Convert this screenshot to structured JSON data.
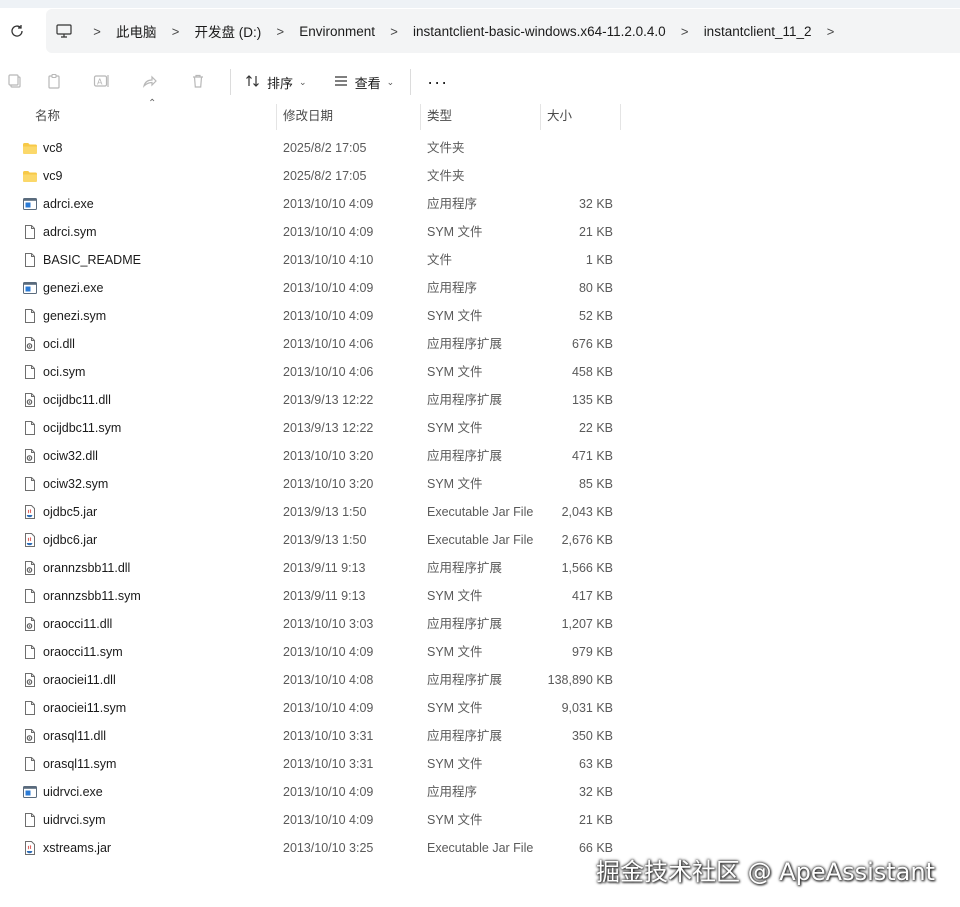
{
  "breadcrumb": [
    {
      "label": "此电脑"
    },
    {
      "label": "开发盘 (D:)"
    },
    {
      "label": "Environment"
    },
    {
      "label": "instantclient-basic-windows.x64-11.2.0.4.0"
    },
    {
      "label": "instantclient_11_2"
    }
  ],
  "toolbar": {
    "sort_label": "排序",
    "view_label": "查看",
    "more_label": "···"
  },
  "columns": {
    "name": "名称",
    "date": "修改日期",
    "type": "类型",
    "size": "大小"
  },
  "files": [
    {
      "icon": "folder",
      "name": "vc8",
      "date": "2025/8/2 17:05",
      "type": "文件夹",
      "size": ""
    },
    {
      "icon": "folder",
      "name": "vc9",
      "date": "2025/8/2 17:05",
      "type": "文件夹",
      "size": ""
    },
    {
      "icon": "exe",
      "name": "adrci.exe",
      "date": "2013/10/10 4:09",
      "type": "应用程序",
      "size": "32 KB"
    },
    {
      "icon": "file",
      "name": "adrci.sym",
      "date": "2013/10/10 4:09",
      "type": "SYM 文件",
      "size": "21 KB"
    },
    {
      "icon": "file",
      "name": "BASIC_README",
      "date": "2013/10/10 4:10",
      "type": "文件",
      "size": "1 KB"
    },
    {
      "icon": "exe",
      "name": "genezi.exe",
      "date": "2013/10/10 4:09",
      "type": "应用程序",
      "size": "80 KB"
    },
    {
      "icon": "file",
      "name": "genezi.sym",
      "date": "2013/10/10 4:09",
      "type": "SYM 文件",
      "size": "52 KB"
    },
    {
      "icon": "dll",
      "name": "oci.dll",
      "date": "2013/10/10 4:06",
      "type": "应用程序扩展",
      "size": "676 KB"
    },
    {
      "icon": "file",
      "name": "oci.sym",
      "date": "2013/10/10 4:06",
      "type": "SYM 文件",
      "size": "458 KB"
    },
    {
      "icon": "dll",
      "name": "ocijdbc11.dll",
      "date": "2013/9/13 12:22",
      "type": "应用程序扩展",
      "size": "135 KB"
    },
    {
      "icon": "file",
      "name": "ocijdbc11.sym",
      "date": "2013/9/13 12:22",
      "type": "SYM 文件",
      "size": "22 KB"
    },
    {
      "icon": "dll",
      "name": "ociw32.dll",
      "date": "2013/10/10 3:20",
      "type": "应用程序扩展",
      "size": "471 KB"
    },
    {
      "icon": "file",
      "name": "ociw32.sym",
      "date": "2013/10/10 3:20",
      "type": "SYM 文件",
      "size": "85 KB"
    },
    {
      "icon": "jar",
      "name": "ojdbc5.jar",
      "date": "2013/9/13 1:50",
      "type": "Executable Jar File",
      "size": "2,043 KB"
    },
    {
      "icon": "jar",
      "name": "ojdbc6.jar",
      "date": "2013/9/13 1:50",
      "type": "Executable Jar File",
      "size": "2,676 KB"
    },
    {
      "icon": "dll",
      "name": "orannzsbb11.dll",
      "date": "2013/9/11 9:13",
      "type": "应用程序扩展",
      "size": "1,566 KB"
    },
    {
      "icon": "file",
      "name": "orannzsbb11.sym",
      "date": "2013/9/11 9:13",
      "type": "SYM 文件",
      "size": "417 KB"
    },
    {
      "icon": "dll",
      "name": "oraocci11.dll",
      "date": "2013/10/10 3:03",
      "type": "应用程序扩展",
      "size": "1,207 KB"
    },
    {
      "icon": "file",
      "name": "oraocci11.sym",
      "date": "2013/10/10 4:09",
      "type": "SYM 文件",
      "size": "979 KB"
    },
    {
      "icon": "dll",
      "name": "oraociei11.dll",
      "date": "2013/10/10 4:08",
      "type": "应用程序扩展",
      "size": "138,890 KB"
    },
    {
      "icon": "file",
      "name": "oraociei11.sym",
      "date": "2013/10/10 4:09",
      "type": "SYM 文件",
      "size": "9,031 KB"
    },
    {
      "icon": "dll",
      "name": "orasql11.dll",
      "date": "2013/10/10 3:31",
      "type": "应用程序扩展",
      "size": "350 KB"
    },
    {
      "icon": "file",
      "name": "orasql11.sym",
      "date": "2013/10/10 3:31",
      "type": "SYM 文件",
      "size": "63 KB"
    },
    {
      "icon": "exe",
      "name": "uidrvci.exe",
      "date": "2013/10/10 4:09",
      "type": "应用程序",
      "size": "32 KB"
    },
    {
      "icon": "file",
      "name": "uidrvci.sym",
      "date": "2013/10/10 4:09",
      "type": "SYM 文件",
      "size": "21 KB"
    },
    {
      "icon": "jar",
      "name": "xstreams.jar",
      "date": "2013/10/10 3:25",
      "type": "Executable Jar File",
      "size": "66 KB"
    }
  ],
  "watermark": "掘金技术社区 @ ApeAssistant"
}
